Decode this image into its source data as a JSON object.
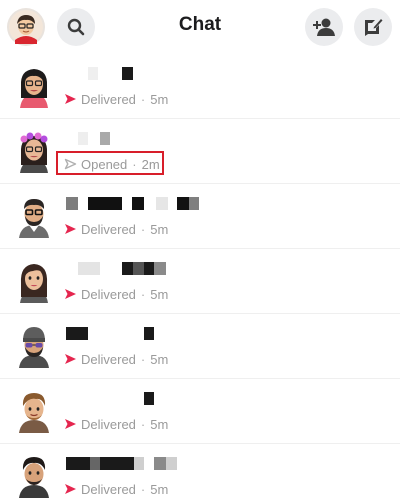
{
  "header": {
    "title": "Chat",
    "icons": [
      "profile-avatar-icon",
      "search-icon",
      "add-friend-icon",
      "new-chat-icon"
    ]
  },
  "colors": {
    "delivered_arrow": "#e5264f",
    "opened_arrow": "#b0b0b0",
    "highlight": "#d81e2a",
    "button_bg": "#ebecee"
  },
  "chats": [
    {
      "status": "Delivered",
      "separator": "·",
      "time": "5m",
      "state": "delivered",
      "avatar": "woman-glasses-avatar"
    },
    {
      "status": "Opened",
      "separator": "·",
      "time": "2m",
      "state": "opened",
      "avatar": "woman-flower-crown-avatar"
    },
    {
      "status": "Delivered",
      "separator": "·",
      "time": "5m",
      "state": "delivered",
      "avatar": "man-glasses-beard-avatar"
    },
    {
      "status": "Delivered",
      "separator": "·",
      "time": "5m",
      "state": "delivered",
      "avatar": "woman-long-hair-avatar"
    },
    {
      "status": "Delivered",
      "separator": "·",
      "time": "5m",
      "state": "delivered",
      "avatar": "man-beanie-sunglasses-avatar"
    },
    {
      "status": "Delivered",
      "separator": "·",
      "time": "5m",
      "state": "delivered",
      "avatar": "man-brown-hair-avatar"
    },
    {
      "status": "Delivered",
      "separator": "·",
      "time": "5m",
      "state": "delivered",
      "avatar": "man-dark-hair-avatar"
    }
  ]
}
